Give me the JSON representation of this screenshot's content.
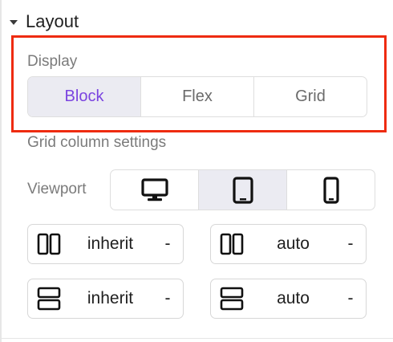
{
  "section": {
    "title": "Layout"
  },
  "display": {
    "label": "Display",
    "options": [
      "Block",
      "Flex",
      "Grid"
    ],
    "selected": "Block"
  },
  "grid": {
    "title": "Grid column settings",
    "viewport_label": "Viewport",
    "viewports": [
      "desktop",
      "tablet",
      "mobile"
    ],
    "selected_viewport": "tablet",
    "fields": [
      {
        "icon": "columns-icon",
        "value": "inherit",
        "unit": "-"
      },
      {
        "icon": "columns-icon",
        "value": "auto",
        "unit": "-"
      },
      {
        "icon": "rows-icon",
        "value": "inherit",
        "unit": "-"
      },
      {
        "icon": "rows-icon",
        "value": "auto",
        "unit": "-"
      }
    ]
  },
  "colors": {
    "accent": "#7b44e0",
    "highlight": "#ee2b10",
    "selected_bg": "#ebebf2"
  }
}
